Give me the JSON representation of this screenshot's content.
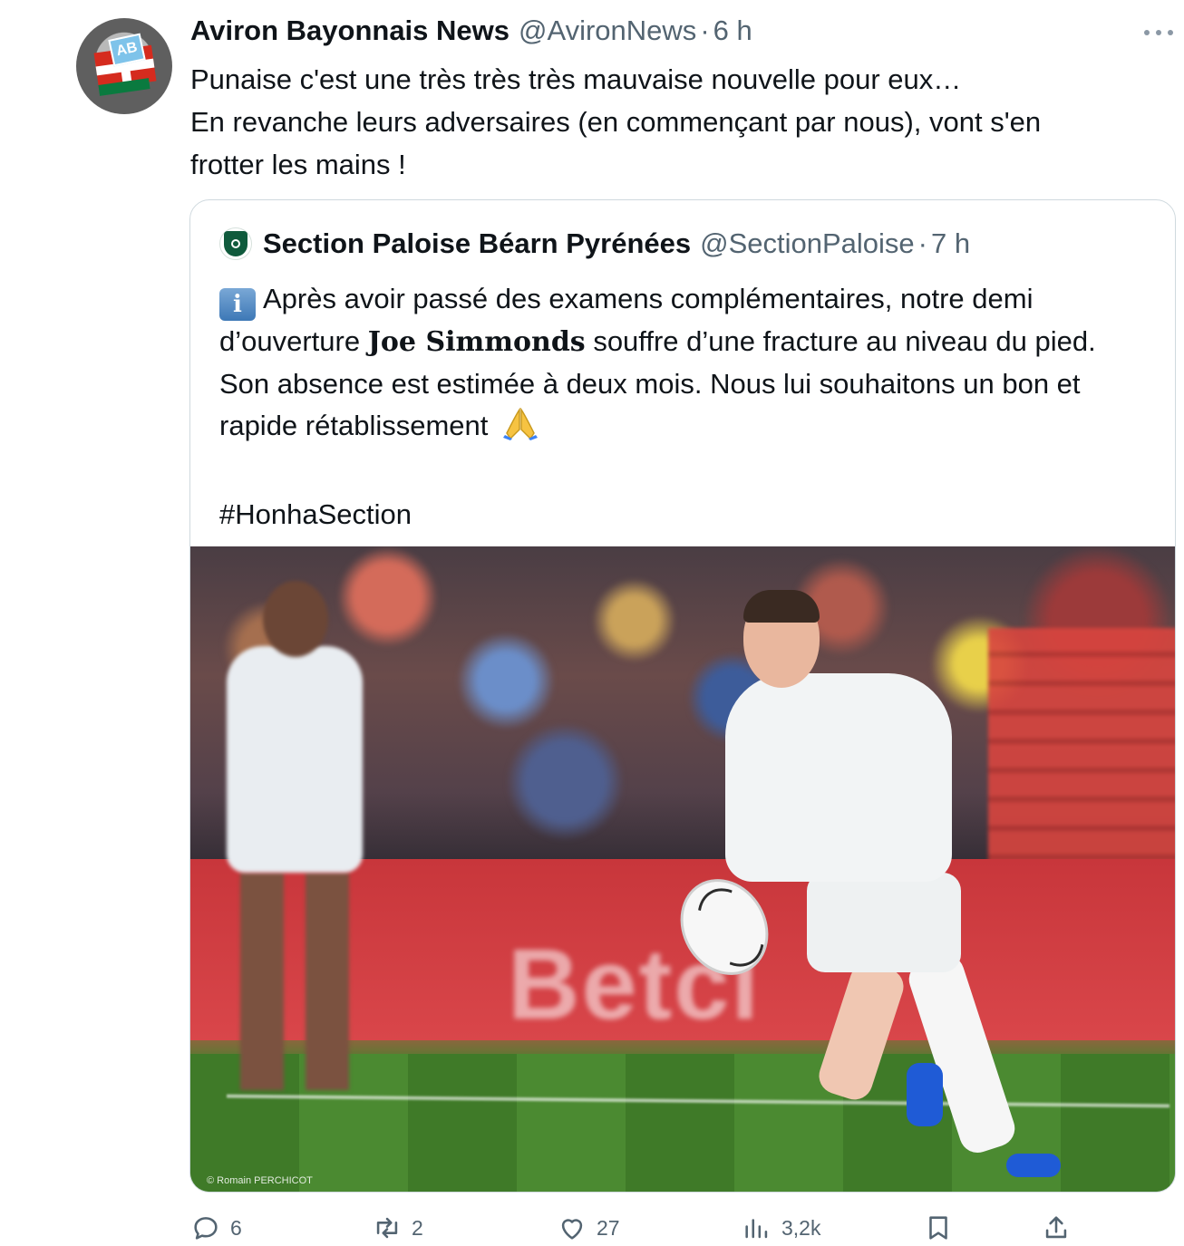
{
  "tweet": {
    "author_name": "Aviron Bayonnais News",
    "author_handle": "@AvironNews",
    "separator": "·",
    "time": "6 h",
    "text_lines": [
      "Punaise c'est une très très très mauvaise nouvelle pour eux…",
      "En revanche leurs adversaires (en commençant par nous), vont s'en",
      "frotter les mains !"
    ],
    "avatar_icon": "aviron-bayonnais-logo",
    "avatar_badge": "AB"
  },
  "quoted": {
    "author_name": "Section Paloise Béarn Pyrénées",
    "author_handle": "@SectionPaloise",
    "separator": "·",
    "time": "7 h",
    "text_part1": "Après avoir passé des examens complémentaires, notre demi d’ouverture ",
    "text_bold": "Joe Simmonds",
    "text_part2": " souffre d’une fracture au niveau du pied. Son absence est estimée à deux mois. Nous lui souhaitons un bon et rapide rétablissement",
    "hashtag": "#HonhaSection",
    "photo_credit": "© Romain PERCHICOT",
    "photo_banner_text": "Betcl"
  },
  "actions": {
    "replies": "6",
    "retweets": "2",
    "likes": "27",
    "views": "3,2k"
  },
  "colors": {
    "text": "#0f1419",
    "secondary": "#536471",
    "border": "#cfd9de"
  }
}
